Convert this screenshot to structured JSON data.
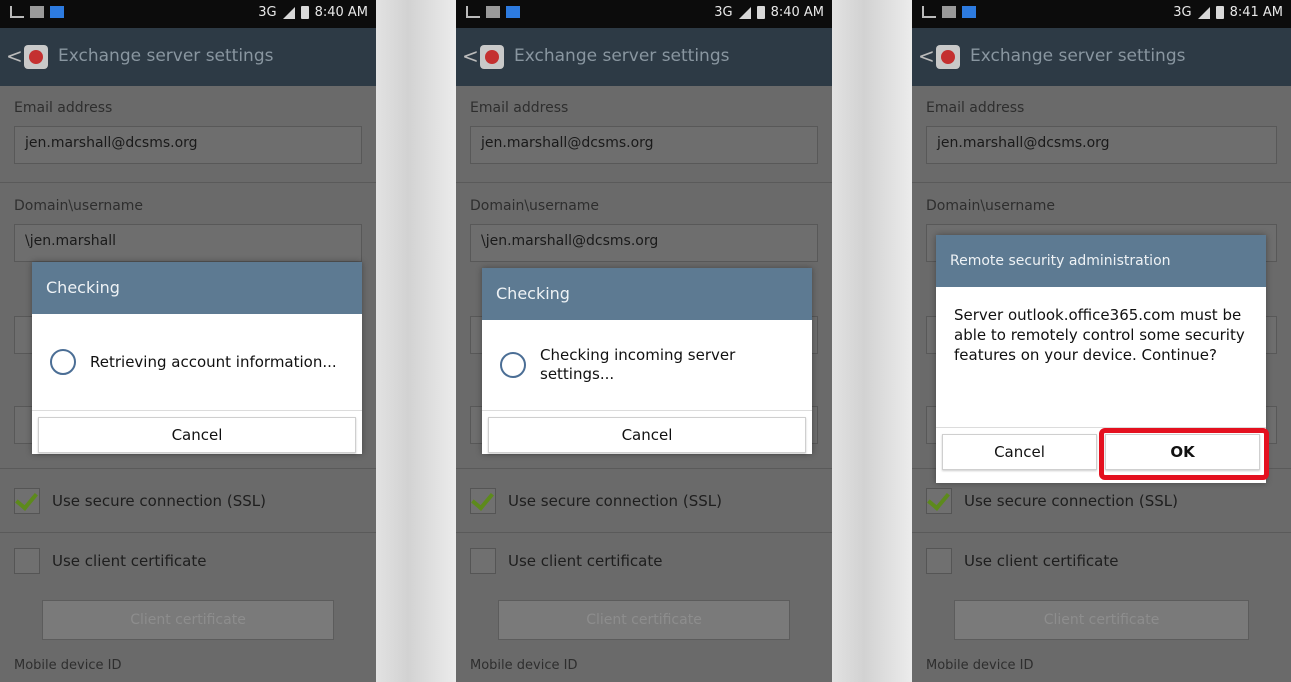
{
  "status": {
    "time1": "8:40 AM",
    "time2": "8:40 AM",
    "time3": "8:41 AM",
    "network": "3G"
  },
  "appbar": {
    "back_glyph": "<",
    "title": "Exchange server settings"
  },
  "form": {
    "email_label": "Email address",
    "email_value": "jen.marshall@dcsms.org",
    "domain_label": "Domain\\username",
    "domain_value_1": "\\jen.marshall",
    "domain_value_2": "\\jen.marshall@dcsms.org",
    "ssl_label": "Use secure connection (SSL)",
    "client_cert_label": "Use client certificate",
    "client_cert_button": "Client certificate",
    "mobile_id_label": "Mobile device ID"
  },
  "dialog_checking_1": {
    "title": "Checking",
    "message": "Retrieving account information...",
    "cancel": "Cancel"
  },
  "dialog_checking_2": {
    "title": "Checking",
    "message": "Checking incoming server settings...",
    "cancel": "Cancel"
  },
  "dialog_security": {
    "title": "Remote security administration",
    "message": "Server outlook.office365.com must be able to remotely control some security features on your device. Continue?",
    "cancel": "Cancel",
    "ok": "OK"
  },
  "colors": {
    "appbar": "#2d3a45",
    "dialog_header": "#5d7a92",
    "highlight": "#e4101f",
    "checkmark": "#5d8a1c"
  }
}
